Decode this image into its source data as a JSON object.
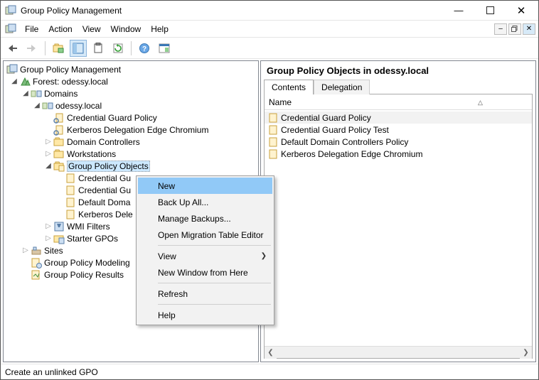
{
  "window": {
    "title": "Group Policy Management"
  },
  "menu": {
    "file": "File",
    "action": "Action",
    "view": "View",
    "window": "Window",
    "help": "Help"
  },
  "tree": {
    "root": "Group Policy Management",
    "forest": "Forest: odessy.local",
    "domains": "Domains",
    "domain": "odessy.local",
    "n_cgp": "Credential Guard Policy",
    "n_kdec": "Kerberos Delegation Edge Chromium",
    "n_dc": "Domain Controllers",
    "n_ws": "Workstations",
    "n_gpo": "Group Policy Objects",
    "n_gpo_cg": "Credential Gu",
    "n_gpo_cgt": "Credential Gu",
    "n_gpo_dd": "Default Doma",
    "n_gpo_kd": "Kerberos Dele",
    "n_wmi": "WMI Filters",
    "n_starter": "Starter GPOs",
    "sites": "Sites",
    "modeling": "Group Policy Modeling",
    "results": "Group Policy Results"
  },
  "detail": {
    "heading": "Group Policy Objects in odessy.local",
    "tab_contents": "Contents",
    "tab_delegation": "Delegation",
    "col_name": "Name",
    "rows": {
      "r0": "Credential Guard Policy",
      "r1": "Credential Guard Policy Test",
      "r2": "Default Domain Controllers Policy",
      "r3": "Kerberos Delegation Edge Chromium"
    }
  },
  "context": {
    "new": "New",
    "backup": "Back Up All...",
    "manage": "Manage Backups...",
    "migration": "Open Migration Table Editor",
    "view": "View",
    "newwin": "New Window from Here",
    "refresh": "Refresh",
    "help": "Help"
  },
  "status": "Create an unlinked GPO"
}
